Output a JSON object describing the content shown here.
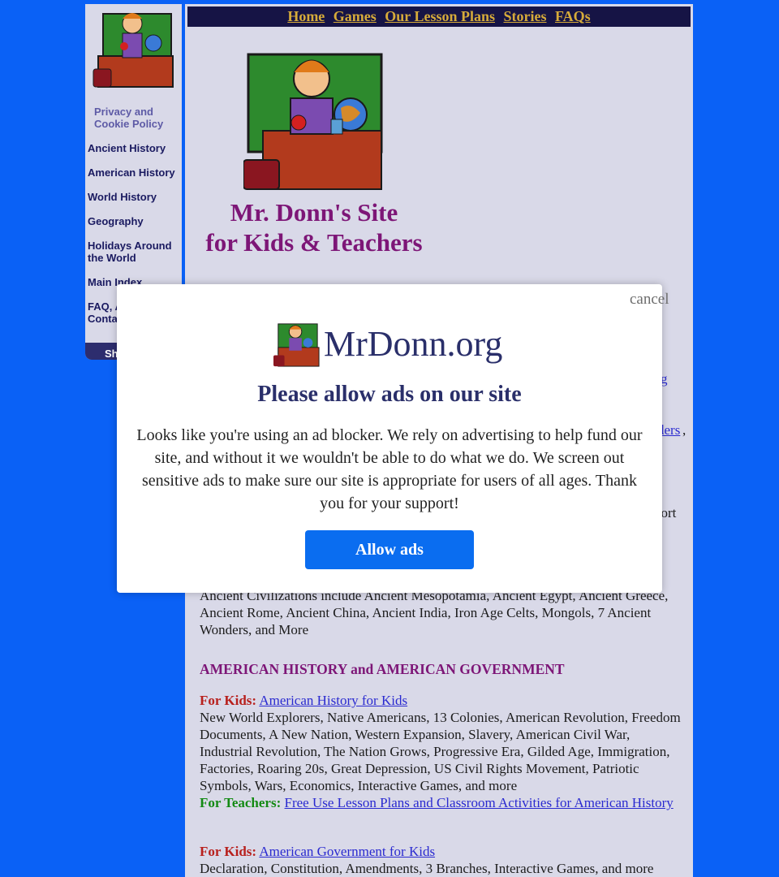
{
  "sidebar": {
    "privacy": "Privacy and Cookie Policy",
    "items": [
      "Ancient History",
      "American History",
      "World History",
      "Geography",
      "Holidays Around the World",
      "Main Index",
      "FAQ, A"
    ],
    "item_extra": "Conta",
    "share": "Sh"
  },
  "topnav": [
    "Home",
    "Games",
    "Our Lesson Plans",
    "Stories",
    "FAQs"
  ],
  "site_title_line1": "Mr. Donn's Site",
  "site_title_line2": "for Kids & Teachers",
  "ancient_desc": "Ancient Civilizations include Ancient Mesopotamia, Ancient Egypt, Ancient Greece, Ancient Rome, Ancient China, Ancient India, Iron Age Celts, Mongols, 7 Ancient Wonders, and More",
  "american_heading": "AMERICAN HISTORY and AMERICAN GOVERNMENT",
  "for_kids": "For Kids:",
  "for_teachers": "For Teachers:",
  "am_hist_link": "American History for Kids",
  "am_hist_desc": "New World Explorers, Native Americans, 13 Colonies, American Revolution, Freedom Documents, A New Nation, Western Expansion, Slavery, American Civil War, Industrial Revolution, The Nation Grows, Progressive Era, Gilded Age, Immigration, Factories, Roaring 20s, Great Depression, US Civil Rights Movement, Patriotic Symbols, Wars, Economics, Interactive Games, and more",
  "am_hist_teachers_link": "Free Use Lesson Plans and Classroom Activities for American History",
  "am_gov_link": "American Government for Kids",
  "am_gov_desc": "Declaration, Constitution, Amendments, 3 Branches, Interactive Games, and more",
  "fragments": {
    "f1": "g",
    "f2": "ders",
    "f3": ",",
    "f4": "hort"
  },
  "modal": {
    "cancel": "cancel",
    "brand": "MrDonn.org",
    "title": "Please allow ads on our site",
    "text": "Looks like you're using an ad blocker. We rely on advertising to help fund our site, and without it we wouldn't be able to do what we do. We screen out sensitive ads to make sure our site is appropriate for users of all ages. Thank you for your support!",
    "button": "Allow ads"
  },
  "colors": {
    "background": "#0a61f6",
    "panel": "#d9d9e8",
    "nav": "#161445",
    "navlink": "#d6ab3a",
    "title": "#7d1677",
    "button": "#0a6df0"
  }
}
